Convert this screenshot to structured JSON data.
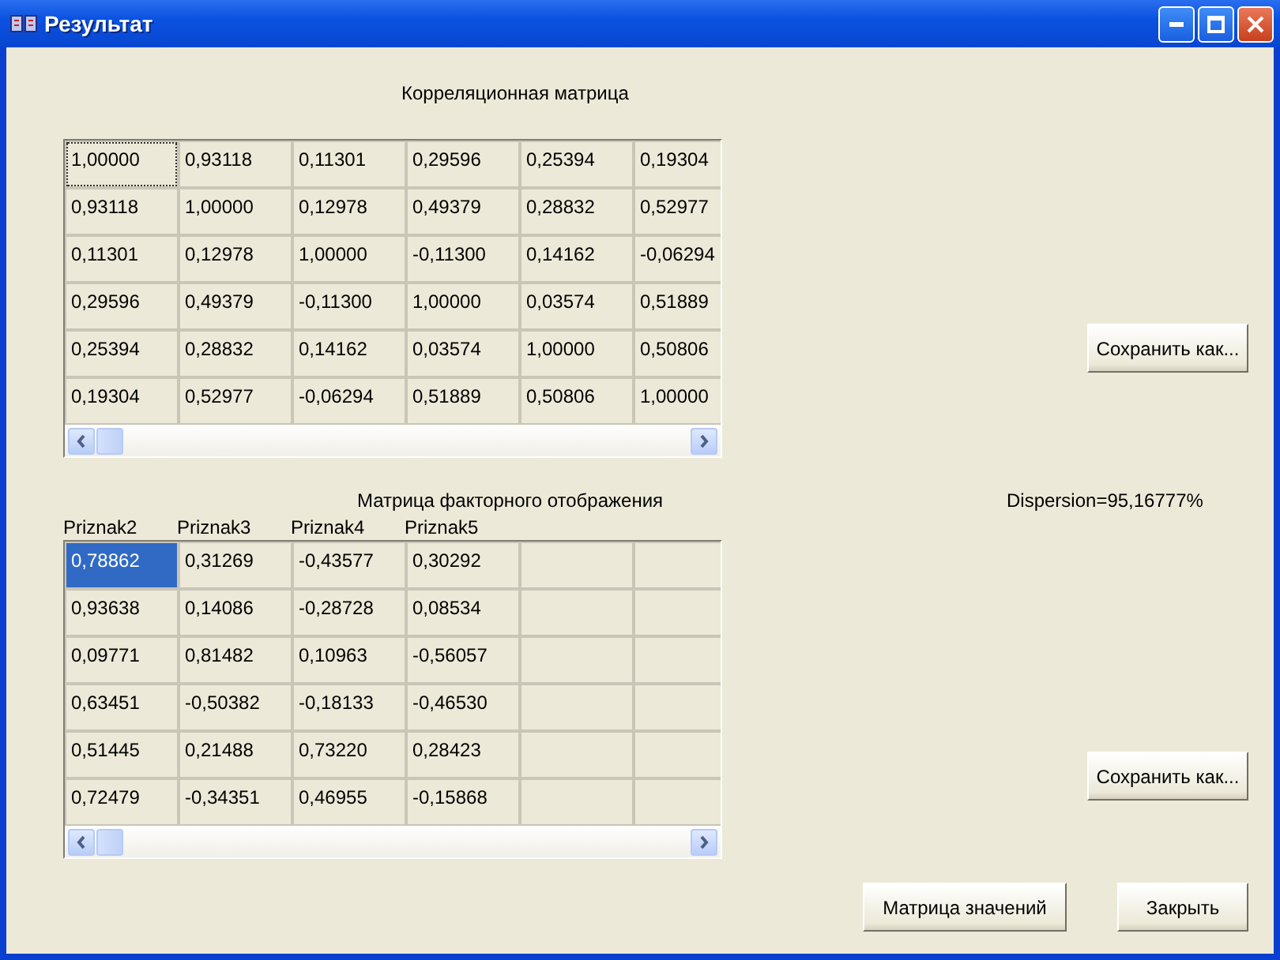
{
  "window": {
    "title": "Результат"
  },
  "correlation": {
    "title": "Корреляционная матрица",
    "focused": false,
    "rows": [
      [
        {
          "text": "1,00000",
          "selected": true
        },
        {
          "text": "0,93118",
          "selected": false
        },
        {
          "text": "0,11301",
          "selected": false
        },
        {
          "text": "0,29596",
          "selected": false
        },
        {
          "text": "0,25394",
          "selected": false
        },
        {
          "text": "0,19304",
          "selected": false
        }
      ],
      [
        {
          "text": "0,93118",
          "selected": false
        },
        {
          "text": "1,00000",
          "selected": false
        },
        {
          "text": "0,12978",
          "selected": false
        },
        {
          "text": "0,49379",
          "selected": false
        },
        {
          "text": "0,28832",
          "selected": false
        },
        {
          "text": "0,52977",
          "selected": false
        }
      ],
      [
        {
          "text": "0,11301",
          "selected": false
        },
        {
          "text": "0,12978",
          "selected": false
        },
        {
          "text": "1,00000",
          "selected": false
        },
        {
          "text": "-0,11300",
          "selected": false
        },
        {
          "text": "0,14162",
          "selected": false
        },
        {
          "text": "-0,06294",
          "selected": false
        }
      ],
      [
        {
          "text": "0,29596",
          "selected": false
        },
        {
          "text": "0,49379",
          "selected": false
        },
        {
          "text": "-0,11300",
          "selected": false
        },
        {
          "text": "1,00000",
          "selected": false
        },
        {
          "text": "0,03574",
          "selected": false
        },
        {
          "text": "0,51889",
          "selected": false
        }
      ],
      [
        {
          "text": "0,25394",
          "selected": false
        },
        {
          "text": "0,28832",
          "selected": false
        },
        {
          "text": "0,14162",
          "selected": false
        },
        {
          "text": "0,03574",
          "selected": false
        },
        {
          "text": "1,00000",
          "selected": false
        },
        {
          "text": "0,50806",
          "selected": false
        }
      ],
      [
        {
          "text": "0,19304",
          "selected": false
        },
        {
          "text": "0,52977",
          "selected": false
        },
        {
          "text": "-0,06294",
          "selected": false
        },
        {
          "text": "0,51889",
          "selected": false
        },
        {
          "text": "0,50806",
          "selected": false
        },
        {
          "text": "1,00000",
          "selected": false
        }
      ]
    ]
  },
  "save_button_1": "Сохранить как...",
  "factor": {
    "title": "Матрица факторного отображения",
    "focused": true,
    "columns": [
      "Priznak2",
      "Priznak3",
      "Priznak4",
      "Priznak5"
    ],
    "rows": [
      [
        {
          "text": "0,78862",
          "selected": true
        },
        {
          "text": "0,31269",
          "selected": false
        },
        {
          "text": "-0,43577",
          "selected": false
        },
        {
          "text": "0,30292",
          "selected": false
        }
      ],
      [
        {
          "text": "0,93638",
          "selected": false
        },
        {
          "text": "0,14086",
          "selected": false
        },
        {
          "text": "-0,28728",
          "selected": false
        },
        {
          "text": "0,08534",
          "selected": false
        }
      ],
      [
        {
          "text": "0,09771",
          "selected": false
        },
        {
          "text": "0,81482",
          "selected": false
        },
        {
          "text": "0,10963",
          "selected": false
        },
        {
          "text": "-0,56057",
          "selected": false
        }
      ],
      [
        {
          "text": "0,63451",
          "selected": false
        },
        {
          "text": "-0,50382",
          "selected": false
        },
        {
          "text": "-0,18133",
          "selected": false
        },
        {
          "text": "-0,46530",
          "selected": false
        }
      ],
      [
        {
          "text": "0,51445",
          "selected": false
        },
        {
          "text": "0,21488",
          "selected": false
        },
        {
          "text": "0,73220",
          "selected": false
        },
        {
          "text": "0,28423",
          "selected": false
        }
      ],
      [
        {
          "text": "0,72479",
          "selected": false
        },
        {
          "text": "-0,34351",
          "selected": false
        },
        {
          "text": "0,46955",
          "selected": false
        },
        {
          "text": "-0,15868",
          "selected": false
        }
      ]
    ]
  },
  "dispersion": "Dispersion=95,16777%",
  "save_button_2": "Сохранить как...",
  "buttons": [
    "Матрица значений",
    "Закрыть"
  ]
}
